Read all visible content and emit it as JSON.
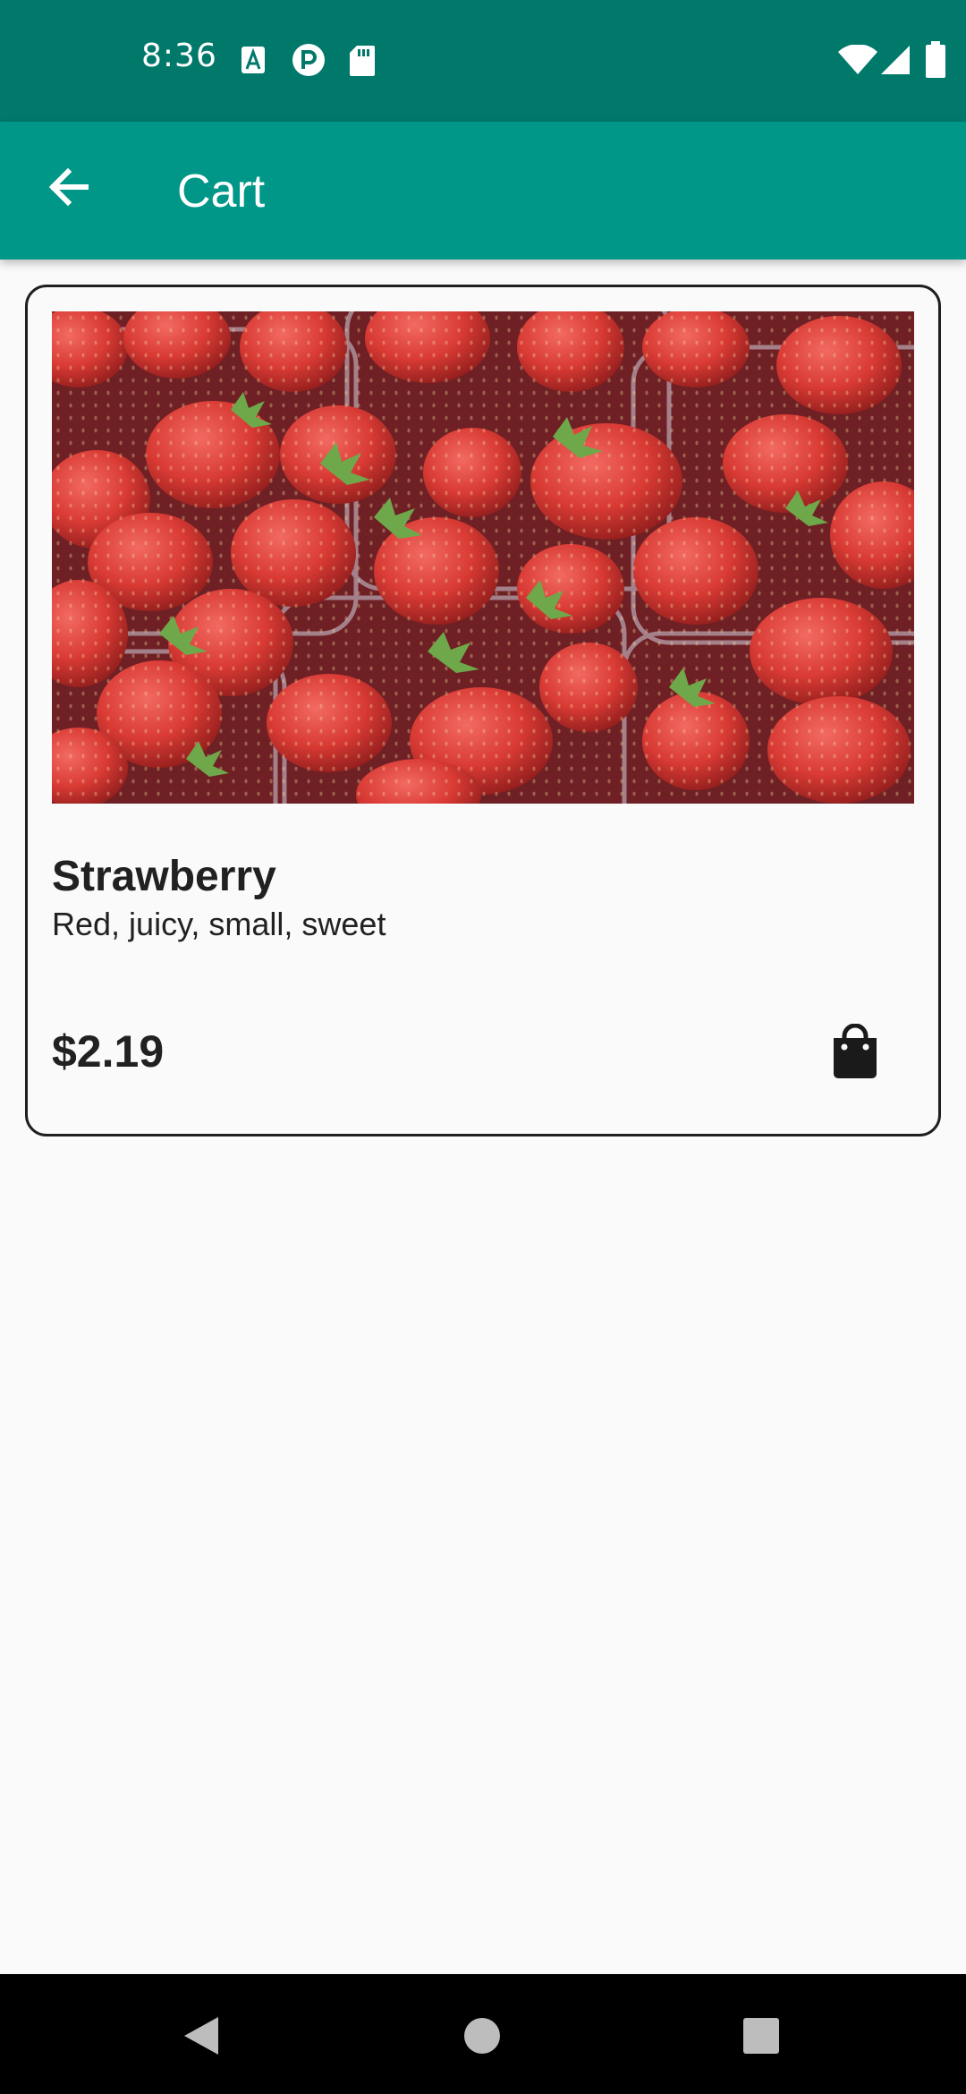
{
  "status_bar": {
    "time": "8:36",
    "icons": [
      "a-notification-icon",
      "p-notification-icon",
      "sd-card-icon",
      "wifi-icon",
      "cell-signal-icon",
      "battery-icon"
    ]
  },
  "app_bar": {
    "title": "Cart",
    "back_icon": "arrow-back-icon"
  },
  "cart": {
    "items": [
      {
        "name": "Strawberry",
        "description": "Red, juicy, small, sweet",
        "price": "$2.19",
        "image": "strawberries-photo",
        "action_icon": "shopping-bag-icon"
      }
    ]
  },
  "nav_bar": {
    "buttons": [
      "back-triangle-icon",
      "home-circle-icon",
      "recents-square-icon"
    ]
  },
  "colors": {
    "status_bar": "#00796b",
    "app_bar": "#009688",
    "background": "#fafafa",
    "text": "#212121"
  }
}
